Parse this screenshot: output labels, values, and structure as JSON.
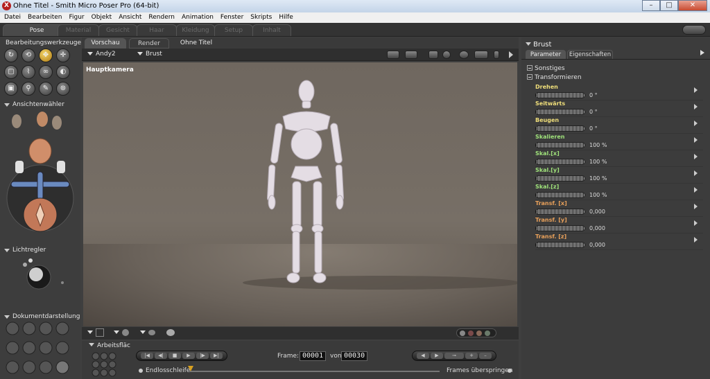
{
  "window": {
    "title": "Ohne Titel - Smith Micro Poser Pro  (64-bit)",
    "buttons": [
      "minimize",
      "maximize",
      "close"
    ]
  },
  "menu": [
    "Datei",
    "Bearbeiten",
    "Figur",
    "Objekt",
    "Ansicht",
    "Rendern",
    "Animation",
    "Fenster",
    "Skripts",
    "Hilfe"
  ],
  "rooms": [
    {
      "label": "Pose",
      "active": true
    },
    {
      "label": "Material",
      "active": false
    },
    {
      "label": "Gesicht",
      "active": false
    },
    {
      "label": "Haar",
      "active": false
    },
    {
      "label": "Kleidung",
      "active": false
    },
    {
      "label": "Setup",
      "active": false
    },
    {
      "label": "Inhalt",
      "active": false
    }
  ],
  "left": {
    "editing_tools_title": "Bearbeitungswerkzeuge",
    "camera_title": "Ansichtenwähler",
    "light_title": "Lichtregler",
    "display_title": "Dokumentdarstellung"
  },
  "viewport": {
    "tabs": [
      "Vorschau",
      "Render",
      "Ohne Titel"
    ],
    "figure_select": "Andy2",
    "part_select": "Brust",
    "camera_label": "Hauptkamera"
  },
  "timeline": {
    "title": "Arbeitsfläc",
    "frame_label": "Frame:",
    "frame_current": "00001",
    "of_label": "von",
    "frame_total": "00030",
    "loop_label": "Endlosschleife",
    "skip_label": "Frames überspringen"
  },
  "params": {
    "title": "Brust",
    "tabs": [
      "Parameter",
      "Eigenschaften"
    ],
    "groups": [
      "Sonstiges",
      "Transformieren"
    ],
    "items": [
      {
        "name": "Drehen",
        "value": "0 °"
      },
      {
        "name": "Seitwärts",
        "value": "0 °"
      },
      {
        "name": "Beugen",
        "value": "0 °"
      },
      {
        "name": "Skalieren",
        "value": "100 %"
      },
      {
        "name": "Skal.[x]",
        "value": "100 %"
      },
      {
        "name": "Skal.[y]",
        "value": "100 %"
      },
      {
        "name": "Skal.[z]",
        "value": "100 %"
      },
      {
        "name": "Transf. [x]",
        "value": "0,000"
      },
      {
        "name": "Transf. [y]",
        "value": "0,000"
      },
      {
        "name": "Transf. [z]",
        "value": "0,000"
      }
    ]
  },
  "colors": {
    "accent_tool": "#d8a020",
    "param_label": "#f0df7a",
    "scale_label": "#9fe27a"
  }
}
